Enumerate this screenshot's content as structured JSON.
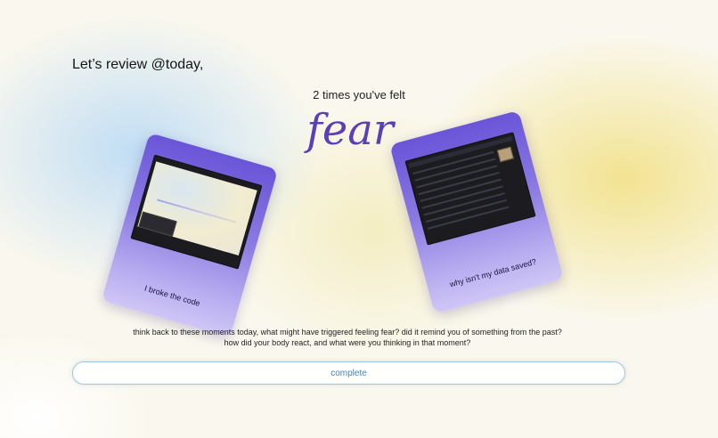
{
  "header": {
    "greeting": "Let’s review @today,"
  },
  "summary": {
    "count_text": "2 times you've felt",
    "emotion": "fear"
  },
  "cards": [
    {
      "caption": "I broke the code"
    },
    {
      "caption": "why isn't my data saved?"
    }
  ],
  "reflection": {
    "line1": "think back to these moments today, what might have triggered feeling fear? did it remind you of something from the past?",
    "line2": "how did your body react, and what were you thinking in that moment?"
  },
  "actions": {
    "complete_label": "complete"
  },
  "colors": {
    "emotion_text": "#5b3fb5",
    "card_top": "#6a55d8",
    "card_bottom": "#cfc6f6",
    "button_border": "#9fc4e6",
    "button_text": "#4a80b8"
  }
}
